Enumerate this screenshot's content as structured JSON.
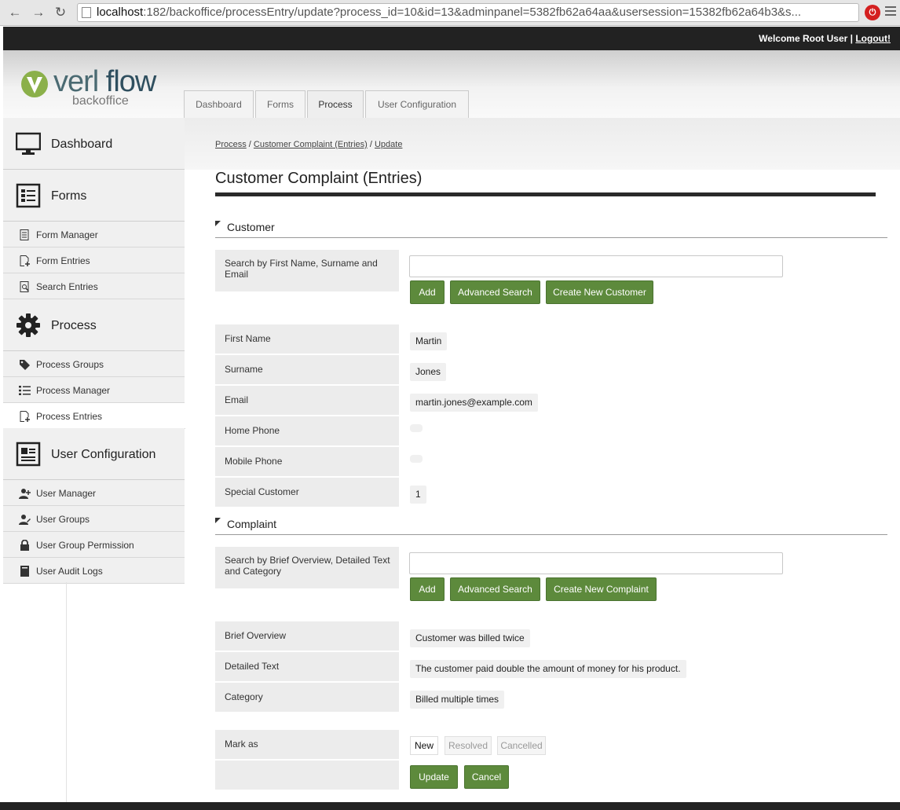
{
  "browser": {
    "url_host": "localhost",
    "url_rest": ":182/backoffice/processEntry/update?process_id=10&id=13&adminpanel=5382fb62a64aa&usersession=15382fb62a64b3&s..."
  },
  "topbar": {
    "welcome": "Welcome Root User |",
    "logout": "Logout!"
  },
  "logo": {
    "word1": "verl",
    "word2": "flow",
    "sub": "backoffice"
  },
  "tabs": [
    "Dashboard",
    "Forms",
    "Process",
    "User Configuration"
  ],
  "sidebar": {
    "dashboard": "Dashboard",
    "forms": "Forms",
    "form_manager": "Form Manager",
    "form_entries": "Form Entries",
    "search_entries": "Search Entries",
    "process": "Process",
    "process_groups": "Process Groups",
    "process_manager": "Process Manager",
    "process_entries": "Process Entries",
    "user_configuration": "User Configuration",
    "user_manager": "User Manager",
    "user_groups": "User Groups",
    "user_group_permission": "User Group Permission",
    "user_audit_logs": "User Audit Logs"
  },
  "breadcrumb": {
    "process": "Process",
    "sep1": " / ",
    "entries": "Customer Complaint (Entries)",
    "sep2": " / ",
    "current": "Update"
  },
  "page_title": "Customer Complaint (Entries)",
  "customer": {
    "heading": "Customer",
    "search_label": "Search by First Name, Surname and Email",
    "search_value": "",
    "buttons": {
      "add": "Add",
      "advanced": "Advanced Search",
      "create": "Create New Customer"
    },
    "fields": {
      "first_name_label": "First Name",
      "first_name": "Martin",
      "surname_label": "Surname",
      "surname": "Jones",
      "email_label": "Email",
      "email": "martin.jones@example.com",
      "home_phone_label": "Home Phone",
      "mobile_phone_label": "Mobile Phone",
      "special_label": "Special Customer",
      "special": "1"
    }
  },
  "complaint": {
    "heading": "Complaint",
    "search_label": "Search by Brief Overview, Detailed Text and Category",
    "search_value": "",
    "buttons": {
      "add": "Add",
      "advanced": "Advanced Search",
      "create": "Create New Complaint"
    },
    "fields": {
      "brief_label": "Brief Overview",
      "brief": "Customer was billed twice",
      "detail_label": "Detailed Text",
      "detail": "The customer paid double the amount of money for his product.",
      "category_label": "Category",
      "category": "Billed multiple times"
    }
  },
  "mark": {
    "label": "Mark as",
    "options": [
      "New",
      "Resolved",
      "Cancelled"
    ],
    "selected": "New"
  },
  "actions": {
    "update": "Update",
    "cancel": "Cancel"
  },
  "colors": {
    "button_green": "#5d8a3c",
    "topbar": "#222222"
  }
}
